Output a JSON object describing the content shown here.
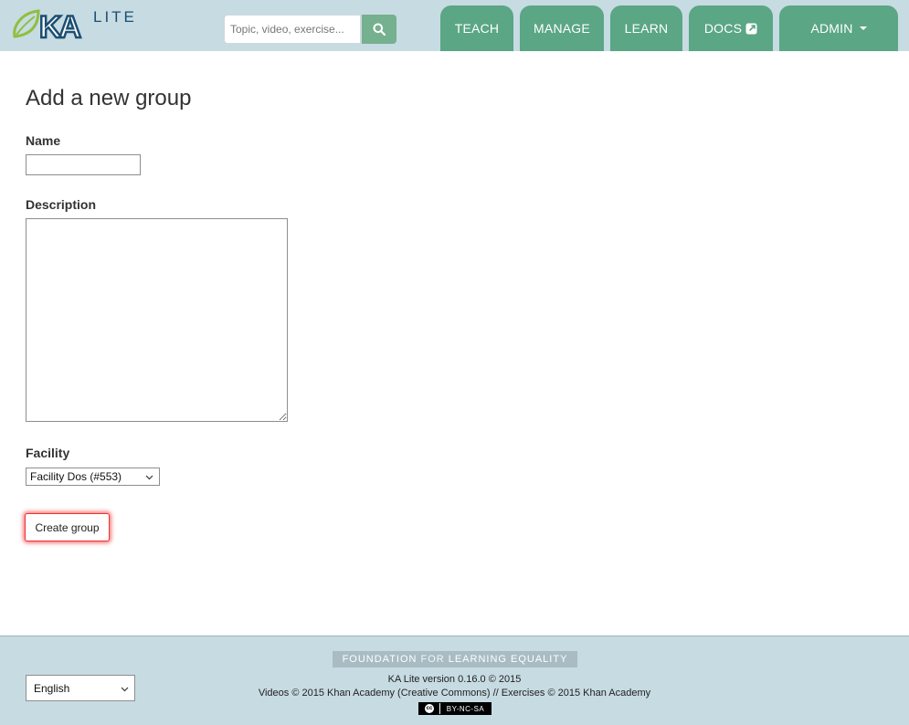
{
  "header": {
    "logo": {
      "ka": "KA",
      "lite": "LITE"
    },
    "search": {
      "placeholder": "Topic, video, exercise...",
      "icon": "search-icon"
    },
    "nav": [
      {
        "label": "TEACH"
      },
      {
        "label": "MANAGE"
      },
      {
        "label": "LEARN"
      },
      {
        "label": "DOCS",
        "icon": "external-link-icon"
      },
      {
        "label": "ADMIN",
        "icon": "caret-down-icon"
      }
    ]
  },
  "form": {
    "title": "Add a new group",
    "name_label": "Name",
    "name_value": "",
    "description_label": "Description",
    "description_value": "",
    "facility_label": "Facility",
    "facility_selected": "Facility Dos (#553)",
    "submit_label": "Create group"
  },
  "footer": {
    "language_selected": "English",
    "fle_banner": {
      "part1": "FOUNDATION",
      "part2": "FOR",
      "part3": "LEARNING EQUALITY"
    },
    "version_text": "KA Lite version 0.16.0 © 2015",
    "credits_text": "Videos © 2015 Khan Academy (Creative Commons) // Exercises © 2015 Khan Academy",
    "license_badge": "BY-NC-SA",
    "license_cc": "cc"
  },
  "colors": {
    "header_bg": "#c7dbe2",
    "nav_tab": "#5aa685",
    "search_button": "#75b08f",
    "logo_blue": "#1b4f72",
    "logo_leaf": "#8fbf3f",
    "focus_glow": "#e33333"
  }
}
